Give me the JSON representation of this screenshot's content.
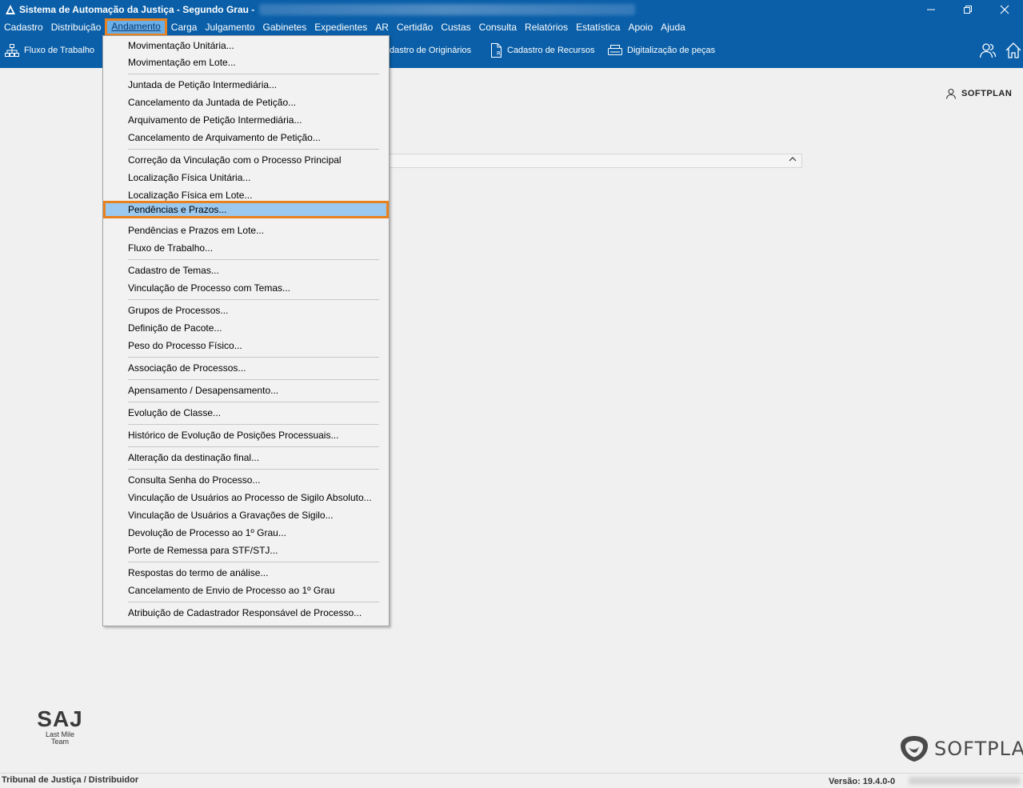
{
  "window": {
    "title": "Sistema de Automação da Justiça - Segundo Grau -"
  },
  "menubar": [
    "Cadastro",
    "Distribuição",
    "Andamento",
    "Carga",
    "Julgamento",
    "Gabinetes",
    "Expedientes",
    "AR",
    "Certidão",
    "Custas",
    "Consulta",
    "Relatórios",
    "Estatística",
    "Apoio",
    "Ajuda"
  ],
  "toolbar": {
    "fluxo": "Fluxo de Trabalho",
    "originarios": "dastro de Originários",
    "recursos": "Cadastro de Recursos",
    "digitalizacao": "Digitalização de peças"
  },
  "user": {
    "name": "SOFTPLAN"
  },
  "dropdown": {
    "items": [
      "Movimentação Unitária...",
      "Movimentação em Lote...",
      "Juntada de Petição Intermediária...",
      "Cancelamento da Juntada de Petição...",
      "Arquivamento de Petição Intermediária...",
      "Cancelamento de Arquivamento de Petição...",
      "Correção da Vinculação com o Processo Principal",
      "Localização Física Unitária...",
      "Localização Física em Lote...",
      "Pendências e Prazos...",
      "Pendências e Prazos em Lote...",
      "Fluxo de Trabalho...",
      "Cadastro de Temas...",
      "Vinculação de Processo com Temas...",
      "Grupos de Processos...",
      "Definição de Pacote...",
      "Peso do Processo Físico...",
      "Associação de Processos...",
      "Apensamento / Desapensamento...",
      "Evolução de Classe...",
      "Histórico de Evolução de Posições Processuais...",
      "Alteração da destinação final...",
      "Consulta Senha do Processo...",
      "Vinculação de Usuários ao Processo de Sigilo Absoluto...",
      "Vinculação de Usuários a Gravações de Sigilo...",
      "Devolução de Processo ao 1º Grau...",
      "Porte de Remessa para STF/STJ...",
      "Respostas do termo de análise...",
      "Cancelamento de Envio de Processo ao 1º Grau",
      "Atribuição de Cadastrador Responsável de Processo..."
    ]
  },
  "logos": {
    "saj": "SAJ",
    "saj_sub1": "Last Mile",
    "saj_sub2": "Team",
    "softplan": "SOFTPLAN"
  },
  "status": {
    "left": "Tribunal de Justiça / Distribuidor",
    "version": "Versão: 19.4.0-0"
  },
  "colors": {
    "accent": "#0a5fa8",
    "highlight": "#e8821e",
    "selection": "#9ac8ef"
  }
}
